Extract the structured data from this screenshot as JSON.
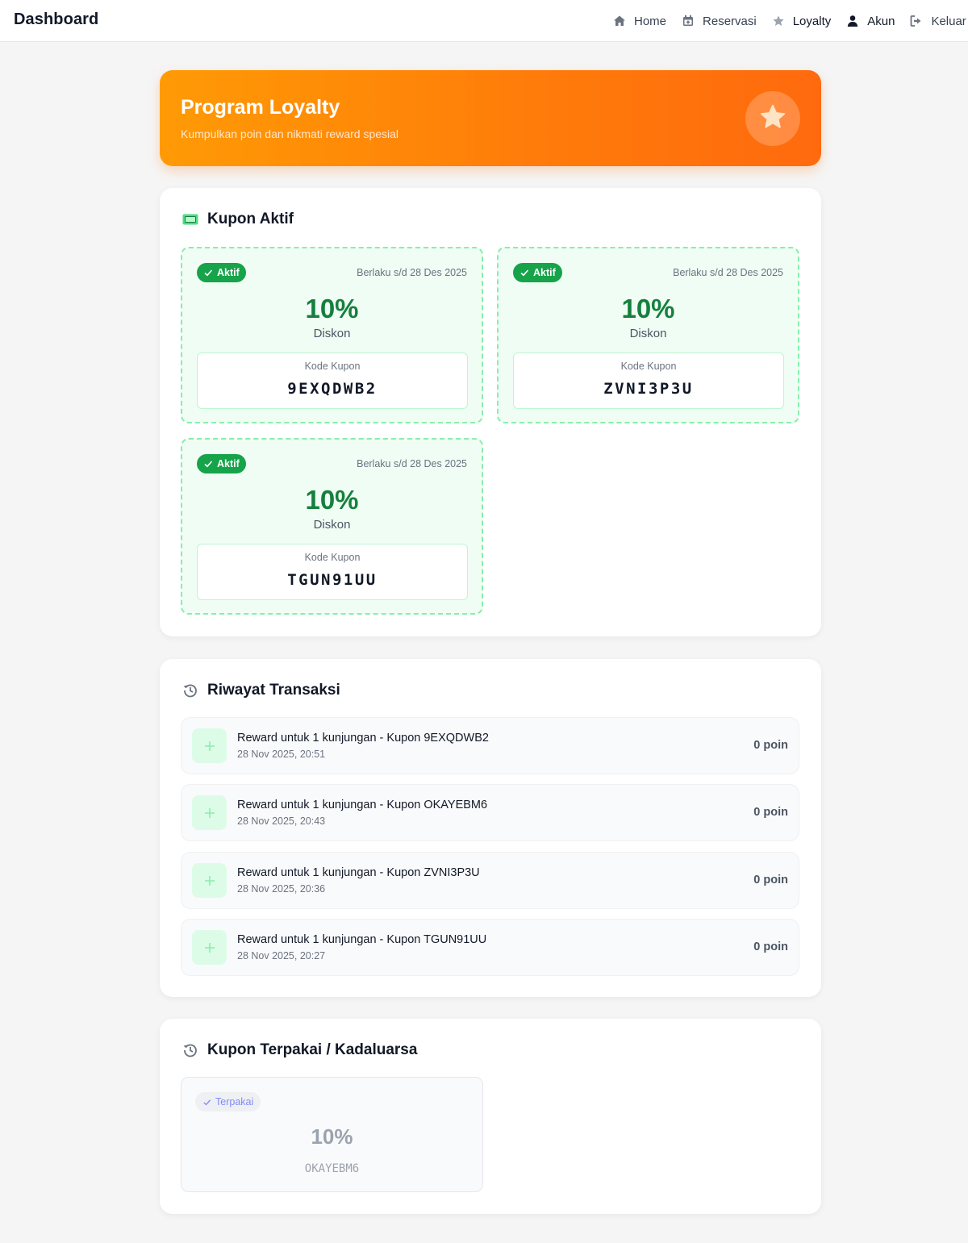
{
  "navbar": {
    "brand": "Dashboard",
    "items": [
      {
        "label": "Home",
        "icon": "home-icon"
      },
      {
        "label": "Reservasi",
        "icon": "calendar-icon"
      },
      {
        "label": "Loyalty",
        "icon": "star-icon",
        "active": true
      },
      {
        "label": "Akun",
        "icon": "user-icon"
      },
      {
        "label": "Keluar",
        "icon": "logout-icon"
      }
    ]
  },
  "hero": {
    "title": "Program Loyalty",
    "subtitle": "Kumpulkan poin dan nikmati reward spesial",
    "icon": "star-icon"
  },
  "active_coupons": {
    "title": "Kupon Aktif",
    "icon": "ticket-icon",
    "items": [
      {
        "status": "Aktif",
        "valid_until": "Berlaku s/d 28 Des 2025",
        "discount": "10%",
        "discount_label": "Diskon",
        "code_label": "Kode Kupon",
        "code": "9EXQDWB2"
      },
      {
        "status": "Aktif",
        "valid_until": "Berlaku s/d 28 Des 2025",
        "discount": "10%",
        "discount_label": "Diskon",
        "code_label": "Kode Kupon",
        "code": "ZVNI3P3U"
      },
      {
        "status": "Aktif",
        "valid_until": "Berlaku s/d 28 Des 2025",
        "discount": "10%",
        "discount_label": "Diskon",
        "code_label": "Kode Kupon",
        "code": "TGUN91UU"
      }
    ]
  },
  "transactions": {
    "title": "Riwayat Transaksi",
    "icon": "history-icon",
    "items": [
      {
        "description": "Reward untuk 1 kunjungan - Kupon 9EXQDWB2",
        "date": "28 Nov 2025, 20:51",
        "points": "0 poin"
      },
      {
        "description": "Reward untuk 1 kunjungan - Kupon OKAYEBM6",
        "date": "28 Nov 2025, 20:43",
        "points": "0 poin"
      },
      {
        "description": "Reward untuk 1 kunjungan - Kupon ZVNI3P3U",
        "date": "28 Nov 2025, 20:36",
        "points": "0 poin"
      },
      {
        "description": "Reward untuk 1 kunjungan - Kupon TGUN91UU",
        "date": "28 Nov 2025, 20:27",
        "points": "0 poin"
      }
    ]
  },
  "used_coupons": {
    "title": "Kupon Terpakai / Kadaluarsa",
    "icon": "history-icon",
    "items": [
      {
        "status": "Terpakai",
        "discount": "10%",
        "code": "OKAYEBM6"
      }
    ]
  },
  "colors": {
    "accent_orange": "#ff8a05",
    "active_green": "#16a34a",
    "used_indigo": "#818cf8"
  }
}
